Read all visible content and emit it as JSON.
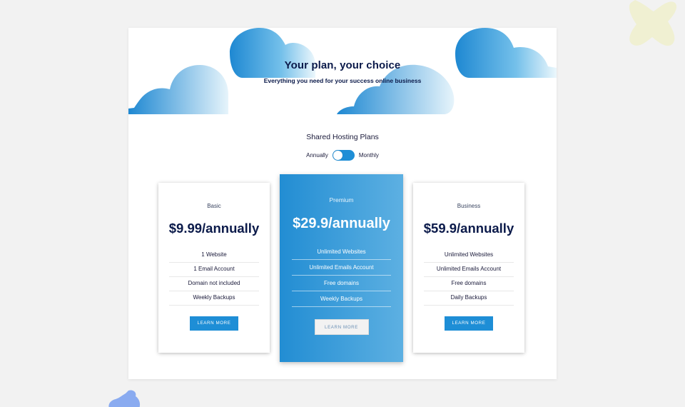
{
  "hero": {
    "title": "Your plan, your choice",
    "subtitle": "Everything you need for your success online business"
  },
  "plans_section": {
    "heading": "Shared Hosting Plans",
    "toggle": {
      "left_label": "Annually",
      "right_label": "Monthly",
      "selected": "Annually"
    }
  },
  "plans": [
    {
      "name": "Basic",
      "price": "$9.99/annually",
      "features": [
        "1 Website",
        "1 Email Account",
        "Domain not included",
        "Weekly Backups"
      ],
      "button": "LEARN MORE"
    },
    {
      "name": "Premium",
      "price": "$29.9/annually",
      "features": [
        "Unlimited Websites",
        "Unlimited Emails Account",
        "Free domains",
        "Weekly Backups"
      ],
      "button": "LEARN MORE"
    },
    {
      "name": "Business",
      "price": "$59.9/annually",
      "features": [
        "Unlimited Websites",
        "Unlimited Emails Account",
        "Free domains",
        "Daily Backups"
      ],
      "button": "LEARN MORE"
    }
  ],
  "colors": {
    "accent": "#1e8ed6",
    "text_dark": "#0b1a4a",
    "background": "#f2f2f2",
    "deco_yellow": "#f0f0d2",
    "deco_blue": "#8aabf0"
  }
}
